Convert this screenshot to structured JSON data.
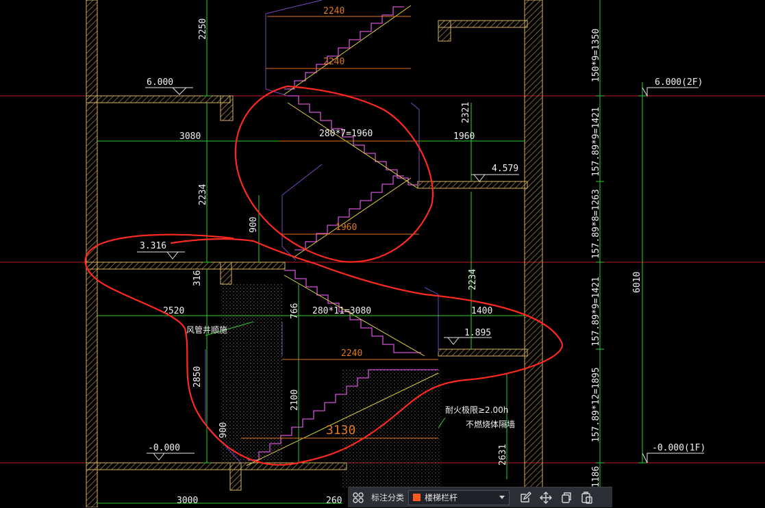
{
  "drawing": {
    "levels": {
      "l6000_left": "6.000",
      "l6000_right": "6.000(2F)",
      "l4579": "4.579",
      "l3316": "3.316",
      "l1895": "1.895",
      "l0_left": "-0.000",
      "l0_right": "-0.000(1F)"
    },
    "dims": {
      "d2250": "2250",
      "d2240_top": "2240",
      "d2240_mid": "2240",
      "d2240_low": "2240",
      "d3080": "3080",
      "d2321": "2321",
      "d1960": "1960",
      "d1960_run": "1960",
      "d280x7": "280*7=1960",
      "d2234_left": "2234",
      "d2234_right": "2234",
      "d900_upper": "900",
      "d900_lower": "900",
      "d316": "316",
      "d766": "766",
      "d2520": "2520",
      "d280x11": "280*11=3080",
      "d1400": "1400",
      "d2850": "2850",
      "d2100": "2100",
      "d3130": "3130",
      "d2631": "2631",
      "d3000": "3000",
      "d260": "260",
      "d6010": "6010",
      "d1186": "1186",
      "d1350": "1350"
    },
    "vertical_steps": {
      "s1": "150*9=1350",
      "s2": "157.89*9=1421",
      "s3": "157.89*8=1263",
      "s4": "157.89*9=1421",
      "s5": "157.89*12=1895"
    },
    "notes": {
      "duct": "风管井顺施",
      "fire1": "耐火极限≥2.00h",
      "fire2": "不燃烧体隔墙"
    }
  },
  "toolbar": {
    "grid_icon": "grid-icon",
    "label": "标注分类",
    "select_value": "楼梯栏杆",
    "select_color": "#ff5a1f",
    "edit_icon": "edit-icon",
    "move_icon": "move-icon",
    "copy_icon": "copy-icon",
    "paste_icon": "paste-icon"
  }
}
